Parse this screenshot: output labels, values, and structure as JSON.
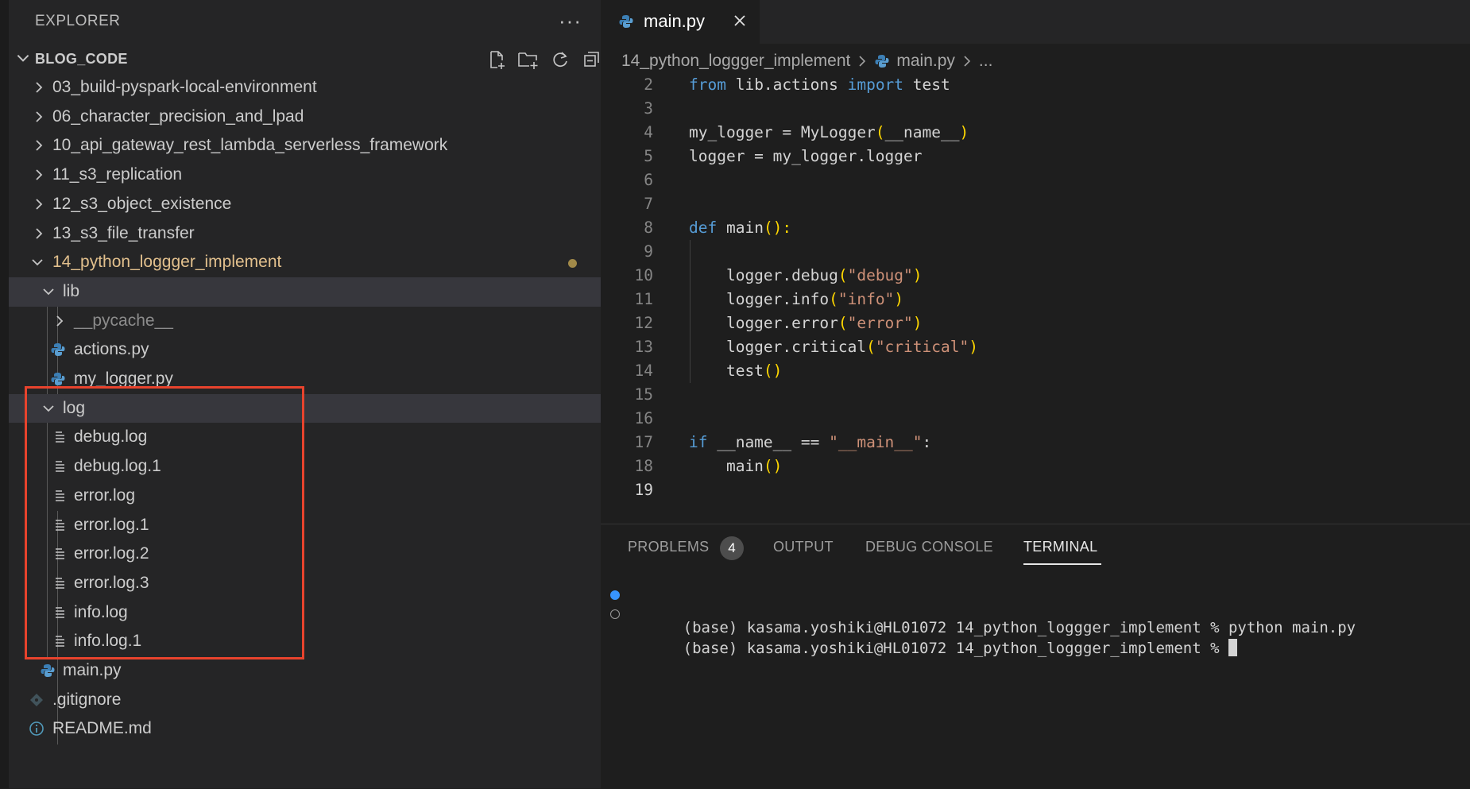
{
  "explorer": {
    "title": "EXPLORER",
    "more": "···"
  },
  "workspace": {
    "name": "BLOG_CODE"
  },
  "tree": [
    {
      "label": "03_build-pyspark-local-environment"
    },
    {
      "label": "06_character_precision_and_lpad"
    },
    {
      "label": "10_api_gateway_rest_lambda_serverless_framework"
    },
    {
      "label": "11_s3_replication"
    },
    {
      "label": "12_s3_object_existence"
    },
    {
      "label": "13_s3_file_transfer"
    },
    {
      "label": "14_python_loggger_implement"
    },
    {
      "label": "lib"
    },
    {
      "label": "__pycache__"
    },
    {
      "label": "actions.py"
    },
    {
      "label": "my_logger.py"
    },
    {
      "label": "log"
    },
    {
      "label": "debug.log"
    },
    {
      "label": "debug.log.1"
    },
    {
      "label": "error.log"
    },
    {
      "label": "error.log.1"
    },
    {
      "label": "error.log.2"
    },
    {
      "label": "error.log.3"
    },
    {
      "label": "info.log"
    },
    {
      "label": "info.log.1"
    },
    {
      "label": "main.py"
    },
    {
      "label": ".gitignore"
    },
    {
      "label": "README.md"
    }
  ],
  "editor": {
    "tab": {
      "label": "main.py"
    },
    "breadcrumb": {
      "folder": "14_python_loggger_implement",
      "file": "main.py",
      "more": "..."
    },
    "line_numbers": [
      "2",
      "3",
      "4",
      "5",
      "6",
      "7",
      "8",
      "9",
      "10",
      "11",
      "12",
      "13",
      "14",
      "15",
      "16",
      "17",
      "18",
      "19"
    ],
    "code": {
      "l2": {
        "a": "from",
        "b": " lib.actions ",
        "c": "import",
        "d": " test"
      },
      "l4": {
        "a": "my_logger = MyLogger",
        "b": "(",
        "c": "__name__",
        "d": ")"
      },
      "l5": {
        "a": "logger = my_logger.logger"
      },
      "l8": {
        "a": "def",
        "b": " main",
        "c": "():"
      },
      "l10": {
        "a": "    logger.debug",
        "b": "(",
        "c": "\"debug\"",
        "d": ")"
      },
      "l11": {
        "a": "    logger.info",
        "b": "(",
        "c": "\"info\"",
        "d": ")"
      },
      "l12": {
        "a": "    logger.error",
        "b": "(",
        "c": "\"error\"",
        "d": ")"
      },
      "l13": {
        "a": "    logger.critical",
        "b": "(",
        "c": "\"critical\"",
        "d": ")"
      },
      "l14": {
        "a": "    test",
        "b": "()"
      },
      "l17": {
        "a": "if",
        "b": " __name__ == ",
        "c": "\"__main__\"",
        "d": ":"
      },
      "l18": {
        "a": "    main",
        "b": "()"
      }
    }
  },
  "panel": {
    "tabs": {
      "problems": "PROBLEMS",
      "output": "OUTPUT",
      "debug": "DEBUG CONSOLE",
      "terminal": "TERMINAL"
    },
    "problems_count": "4",
    "terminal": {
      "line1": "(base) kasama.yoshiki@HL01072 14_python_loggger_implement % python main.py",
      "line2": "(base) kasama.yoshiki@HL01072 14_python_loggger_implement % "
    }
  },
  "colors": {
    "accent": "#3794ff",
    "modified": "#e2c08d",
    "highlight_box": "#e8432d"
  }
}
